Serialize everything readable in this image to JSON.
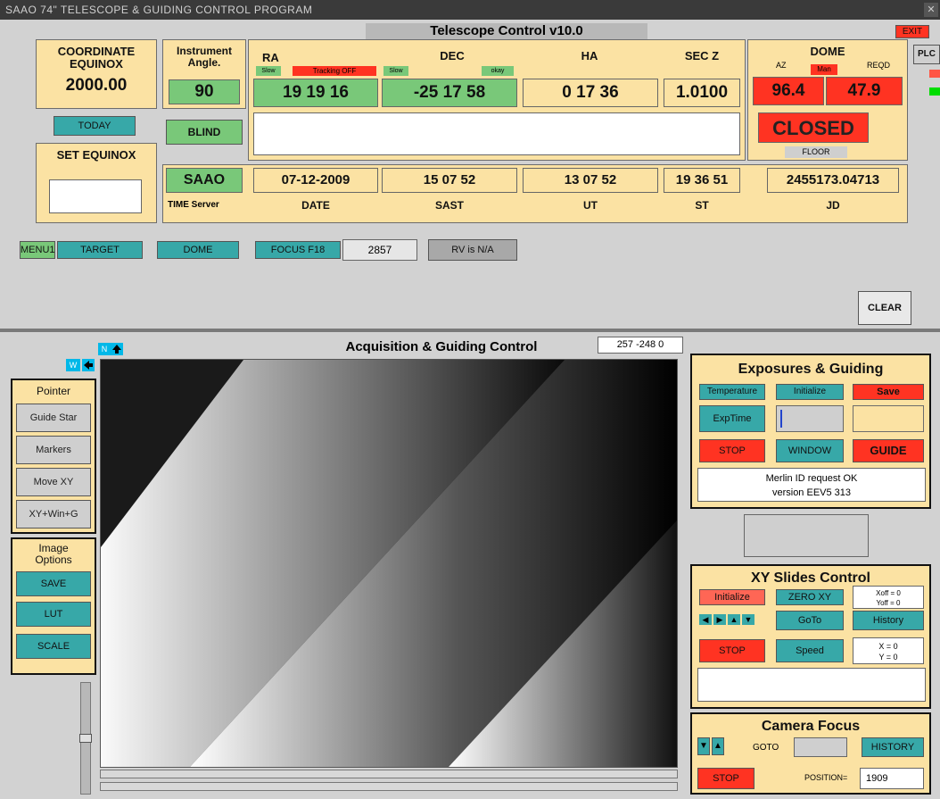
{
  "window": {
    "title": "SAAO 74\" TELESCOPE & GUIDING CONTROL PROGRAM"
  },
  "header": {
    "title": "Telescope Control v10.0",
    "exit_label": "EXIT",
    "plc_label": "PLC"
  },
  "coord": {
    "label1": "COORDINATE",
    "label2": "EQUINOX",
    "value": "2000.00",
    "today_label": "TODAY",
    "set_equinox_label": "SET EQUINOX"
  },
  "instrument": {
    "label1": "Instrument",
    "label2": "Angle.",
    "value": "90",
    "blind_label": "BLIND",
    "site_label": "SAAO",
    "time_server_label": "TIME Server"
  },
  "ra": {
    "label": "RA",
    "slow": "Slow",
    "tracking": "Tracking OFF",
    "value": "19 19 16"
  },
  "dec": {
    "label": "DEC",
    "slow": "Slow",
    "okay": "okay",
    "value": "-25 17 58"
  },
  "ha": {
    "label": "HA",
    "value": "0 17 36"
  },
  "secz": {
    "label": "SEC Z",
    "value": "1.0100"
  },
  "dome": {
    "label": "DOME",
    "az": "AZ",
    "man": "Man",
    "reqd": "REQD",
    "az_value": "96.4",
    "reqd_value": "47.9",
    "status": "CLOSED",
    "floor": "FLOOR"
  },
  "times": {
    "date": "07-12-2009",
    "date_label": "DATE",
    "sast": "15 07 52",
    "sast_label": "SAST",
    "ut": "13 07 52",
    "ut_label": "UT",
    "st": "19 36 51",
    "st_label": "ST",
    "jd": "2455173.04713",
    "jd_label": "JD"
  },
  "menu": {
    "menu1": "MENU1",
    "target": "TARGET",
    "dome": "DOME",
    "focus": "FOCUS F18",
    "focus_value": "2857",
    "rv": "RV is N/A",
    "clear": "CLEAR"
  },
  "acq": {
    "title": "Acquisition & Guiding Control",
    "coords": "257 -248 0",
    "n_label": "N",
    "w_label": "W"
  },
  "pointer": {
    "title": "Pointer",
    "items": [
      "Guide Star",
      "Markers",
      "Move XY",
      "XY+Win+G"
    ]
  },
  "image_options": {
    "title1": "Image",
    "title2": "Options",
    "items": [
      "SAVE",
      "LUT",
      "SCALE"
    ]
  },
  "exposures": {
    "title": "Exposures & Guiding",
    "temperature": "Temperature",
    "initialize": "Initialize",
    "save": "Save",
    "exptime": "ExpTime",
    "stop": "STOP",
    "window": "WINDOW",
    "guide": "GUIDE",
    "msg1": "Merlin ID request OK",
    "msg2": "version EEV5 313"
  },
  "xy": {
    "title": "XY Slides Control",
    "initialize": "Initialize",
    "zero": "ZERO XY",
    "xoff": "Xoff = 0",
    "yoff": "Yoff = 0",
    "goto": "GoTo",
    "history": "History",
    "stop": "STOP",
    "speed": "Speed",
    "x": "X = 0",
    "y": "Y = 0"
  },
  "focus_panel": {
    "title": "Camera Focus",
    "goto": "GOTO",
    "history": "HISTORY",
    "stop": "STOP",
    "position_label": "POSITION=",
    "position_value": "1909"
  },
  "colors": {
    "cream": "#fbe2a3",
    "green": "#79c879",
    "teal": "#37a8a8",
    "red": "#ff3322"
  }
}
